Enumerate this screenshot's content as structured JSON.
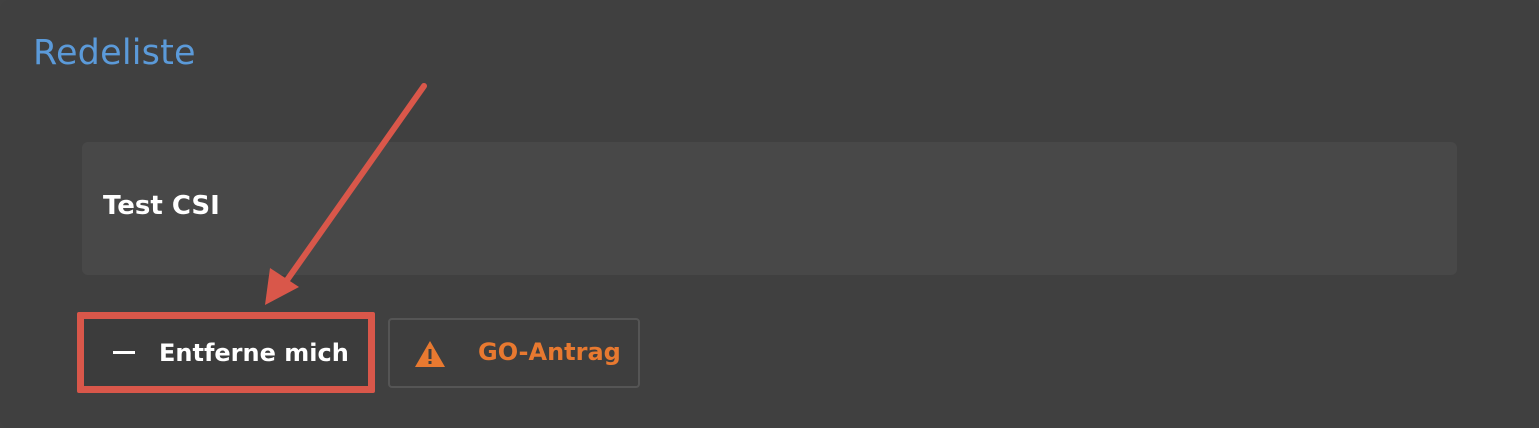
{
  "section": {
    "title": "Redeliste"
  },
  "speakers": [
    {
      "name": "Test CSI"
    }
  ],
  "actions": {
    "remove_label": "Entferne mich",
    "go_label": "GO-Antrag"
  },
  "colors": {
    "title": "#5b9ad9",
    "go_accent": "#e87930",
    "annotation": "#d9574a"
  },
  "icons": {
    "remove": "minus-icon",
    "go": "warning-icon"
  }
}
